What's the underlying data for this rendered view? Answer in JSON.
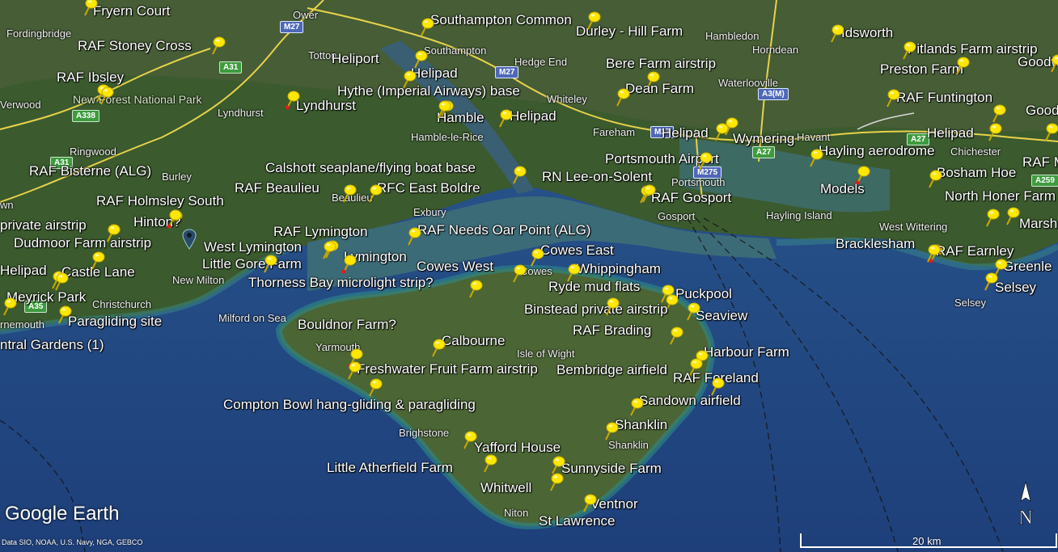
{
  "branding": {
    "logo": "Google Earth",
    "credits": "Data SIO, NOAA, U.S. Navy, NGA, GEBCO"
  },
  "scale": {
    "label": "20 km"
  },
  "compass": {
    "letter": "N"
  },
  "roads": [
    "M27",
    "M271",
    "A31",
    "A338",
    "A3(M)",
    "A27",
    "A259",
    "M275",
    "A35"
  ],
  "towns": [
    "Fordingbridge",
    "Ower",
    "Totton",
    "Southampton",
    "Hedge End",
    "Hambledon",
    "Horndean",
    "Waterlooville",
    "Verwood",
    "New Forest National Park",
    "Lyndhurst",
    "Ringwood",
    "Burley",
    "Hamble-le-Rice",
    "Whiteley",
    "Fareham",
    "Havant",
    "Chichester",
    "Beaulieu",
    "Exbury",
    "Portsmouth",
    "Gosport",
    "Hayling Island",
    "West Wittering",
    "New Milton",
    "Christchurch",
    "Milford on Sea",
    "Cowes",
    "Yarmouth",
    "Isle of Wight",
    "Brighstone",
    "Shanklin",
    "Niton",
    "Selsey",
    "rnemouth",
    "wn"
  ],
  "places": [
    {
      "name": "Fryern Court",
      "color": "yellow"
    },
    {
      "name": "RAF Stoney Cross",
      "color": "yellow"
    },
    {
      "name": "RAF Ibsley",
      "color": "yellow"
    },
    {
      "name": "Southampton Common",
      "color": "yellow"
    },
    {
      "name": "Durley - Hill Farm",
      "color": "yellow"
    },
    {
      "name": "Idsworth",
      "color": "yellow"
    },
    {
      "name": "Pitlands Farm airstrip",
      "color": "yellow"
    },
    {
      "name": "Goodw",
      "color": "yellow"
    },
    {
      "name": "Heliport",
      "color": "yellow"
    },
    {
      "name": "Bere Farm airstrip",
      "color": "yellow"
    },
    {
      "name": "Preston Farm",
      "color": "yellow"
    },
    {
      "name": "Helipad",
      "color": "yellow"
    },
    {
      "name": "Hythe (Imperial Airways) base",
      "color": "yellow"
    },
    {
      "name": "Dean Farm",
      "color": "yellow"
    },
    {
      "name": "Lyndhurst",
      "color": "red"
    },
    {
      "name": "Hamble",
      "color": "yellow"
    },
    {
      "name": "RAF Funtington",
      "color": "yellow"
    },
    {
      "name": "Goodwo",
      "color": "yellow"
    },
    {
      "name": "Helipad",
      "color": "yellow"
    },
    {
      "name": "Helipad",
      "color": "yellow"
    },
    {
      "name": "Wymering",
      "color": "yellow"
    },
    {
      "name": "Helipad",
      "color": "yellow"
    },
    {
      "name": "Hayling aerodrome",
      "color": "yellow"
    },
    {
      "name": "RAF Bisterne (ALG)",
      "color": "yellow"
    },
    {
      "name": "Portsmouth Airport",
      "color": "yellow"
    },
    {
      "name": "RAF M",
      "color": "yellow"
    },
    {
      "name": "Calshott seaplane/flying boat base",
      "color": "yellow"
    },
    {
      "name": "RN Lee-on-Solent",
      "color": "yellow"
    },
    {
      "name": "Bosham Hoe",
      "color": "yellow"
    },
    {
      "name": "RAF Beaulieu",
      "color": "yellow"
    },
    {
      "name": "RFC East Boldre",
      "color": "yellow"
    },
    {
      "name": "Models",
      "color": "red"
    },
    {
      "name": "RAF Holmsley South",
      "color": "yellow"
    },
    {
      "name": "RAF Gosport",
      "color": "yellow"
    },
    {
      "name": "North Honer Farm",
      "color": "yellow"
    },
    {
      "name": "Hinton?",
      "color": "red"
    },
    {
      "name": "private airstrip",
      "color": "yellow"
    },
    {
      "name": "Marsh Fa",
      "color": "yellow"
    },
    {
      "name": "RAF Lymington",
      "color": "yellow"
    },
    {
      "name": "RAF Needs Oar Point (ALG)",
      "color": "yellow"
    },
    {
      "name": "Dudmoor Farm airstrip",
      "color": "yellow"
    },
    {
      "name": "Bracklesham",
      "color": "red"
    },
    {
      "name": "West Lymington",
      "color": "yellow"
    },
    {
      "name": "Cowes East",
      "color": "yellow"
    },
    {
      "name": "RAF Earnley",
      "color": "yellow"
    },
    {
      "name": "Helipad",
      "color": "yellow"
    },
    {
      "name": "Lymington",
      "color": "red"
    },
    {
      "name": "Little Gore Farm",
      "color": "yellow"
    },
    {
      "name": "Castle Lane",
      "color": "yellow"
    },
    {
      "name": "Cowes West",
      "color": "yellow"
    },
    {
      "name": "Whippingham",
      "color": "yellow"
    },
    {
      "name": "Greenle",
      "color": "yellow"
    },
    {
      "name": "Thorness Bay microlight strip?",
      "color": "yellow"
    },
    {
      "name": "Ryde mud flats",
      "color": "yellow"
    },
    {
      "name": "Selsey",
      "color": "yellow"
    },
    {
      "name": "Meyrick Park",
      "color": "yellow"
    },
    {
      "name": "Puckpool",
      "color": "yellow"
    },
    {
      "name": "Binstead private airstrip",
      "color": "yellow"
    },
    {
      "name": "Seaview",
      "color": "yellow"
    },
    {
      "name": "Paragliding site",
      "color": "yellow"
    },
    {
      "name": "Bouldnor Farm?",
      "color": "red"
    },
    {
      "name": "RAF Brading",
      "color": "yellow"
    },
    {
      "name": "ntral Gardens (1)",
      "color": "yellow"
    },
    {
      "name": "Calbourne",
      "color": "yellow"
    },
    {
      "name": "Harbour Farm",
      "color": "yellow"
    },
    {
      "name": "Freshwater Fruit Farm airstrip",
      "color": "yellow"
    },
    {
      "name": "Bembridge airfield",
      "color": "yellow"
    },
    {
      "name": "RAF Foreland",
      "color": "yellow"
    },
    {
      "name": "Compton Bowl hang-gliding &  paragliding",
      "color": "yellow"
    },
    {
      "name": "Sandown airfield",
      "color": "yellow"
    },
    {
      "name": "Shanklin",
      "color": "yellow"
    },
    {
      "name": "Yafford House",
      "color": "yellow"
    },
    {
      "name": "Little Atherfield Farm",
      "color": "yellow"
    },
    {
      "name": "Sunnyside Farm",
      "color": "yellow"
    },
    {
      "name": "Whitwell",
      "color": "yellow"
    },
    {
      "name": "Ventnor",
      "color": "yellow"
    },
    {
      "name": "St Lawrence",
      "color": "yellow"
    }
  ]
}
